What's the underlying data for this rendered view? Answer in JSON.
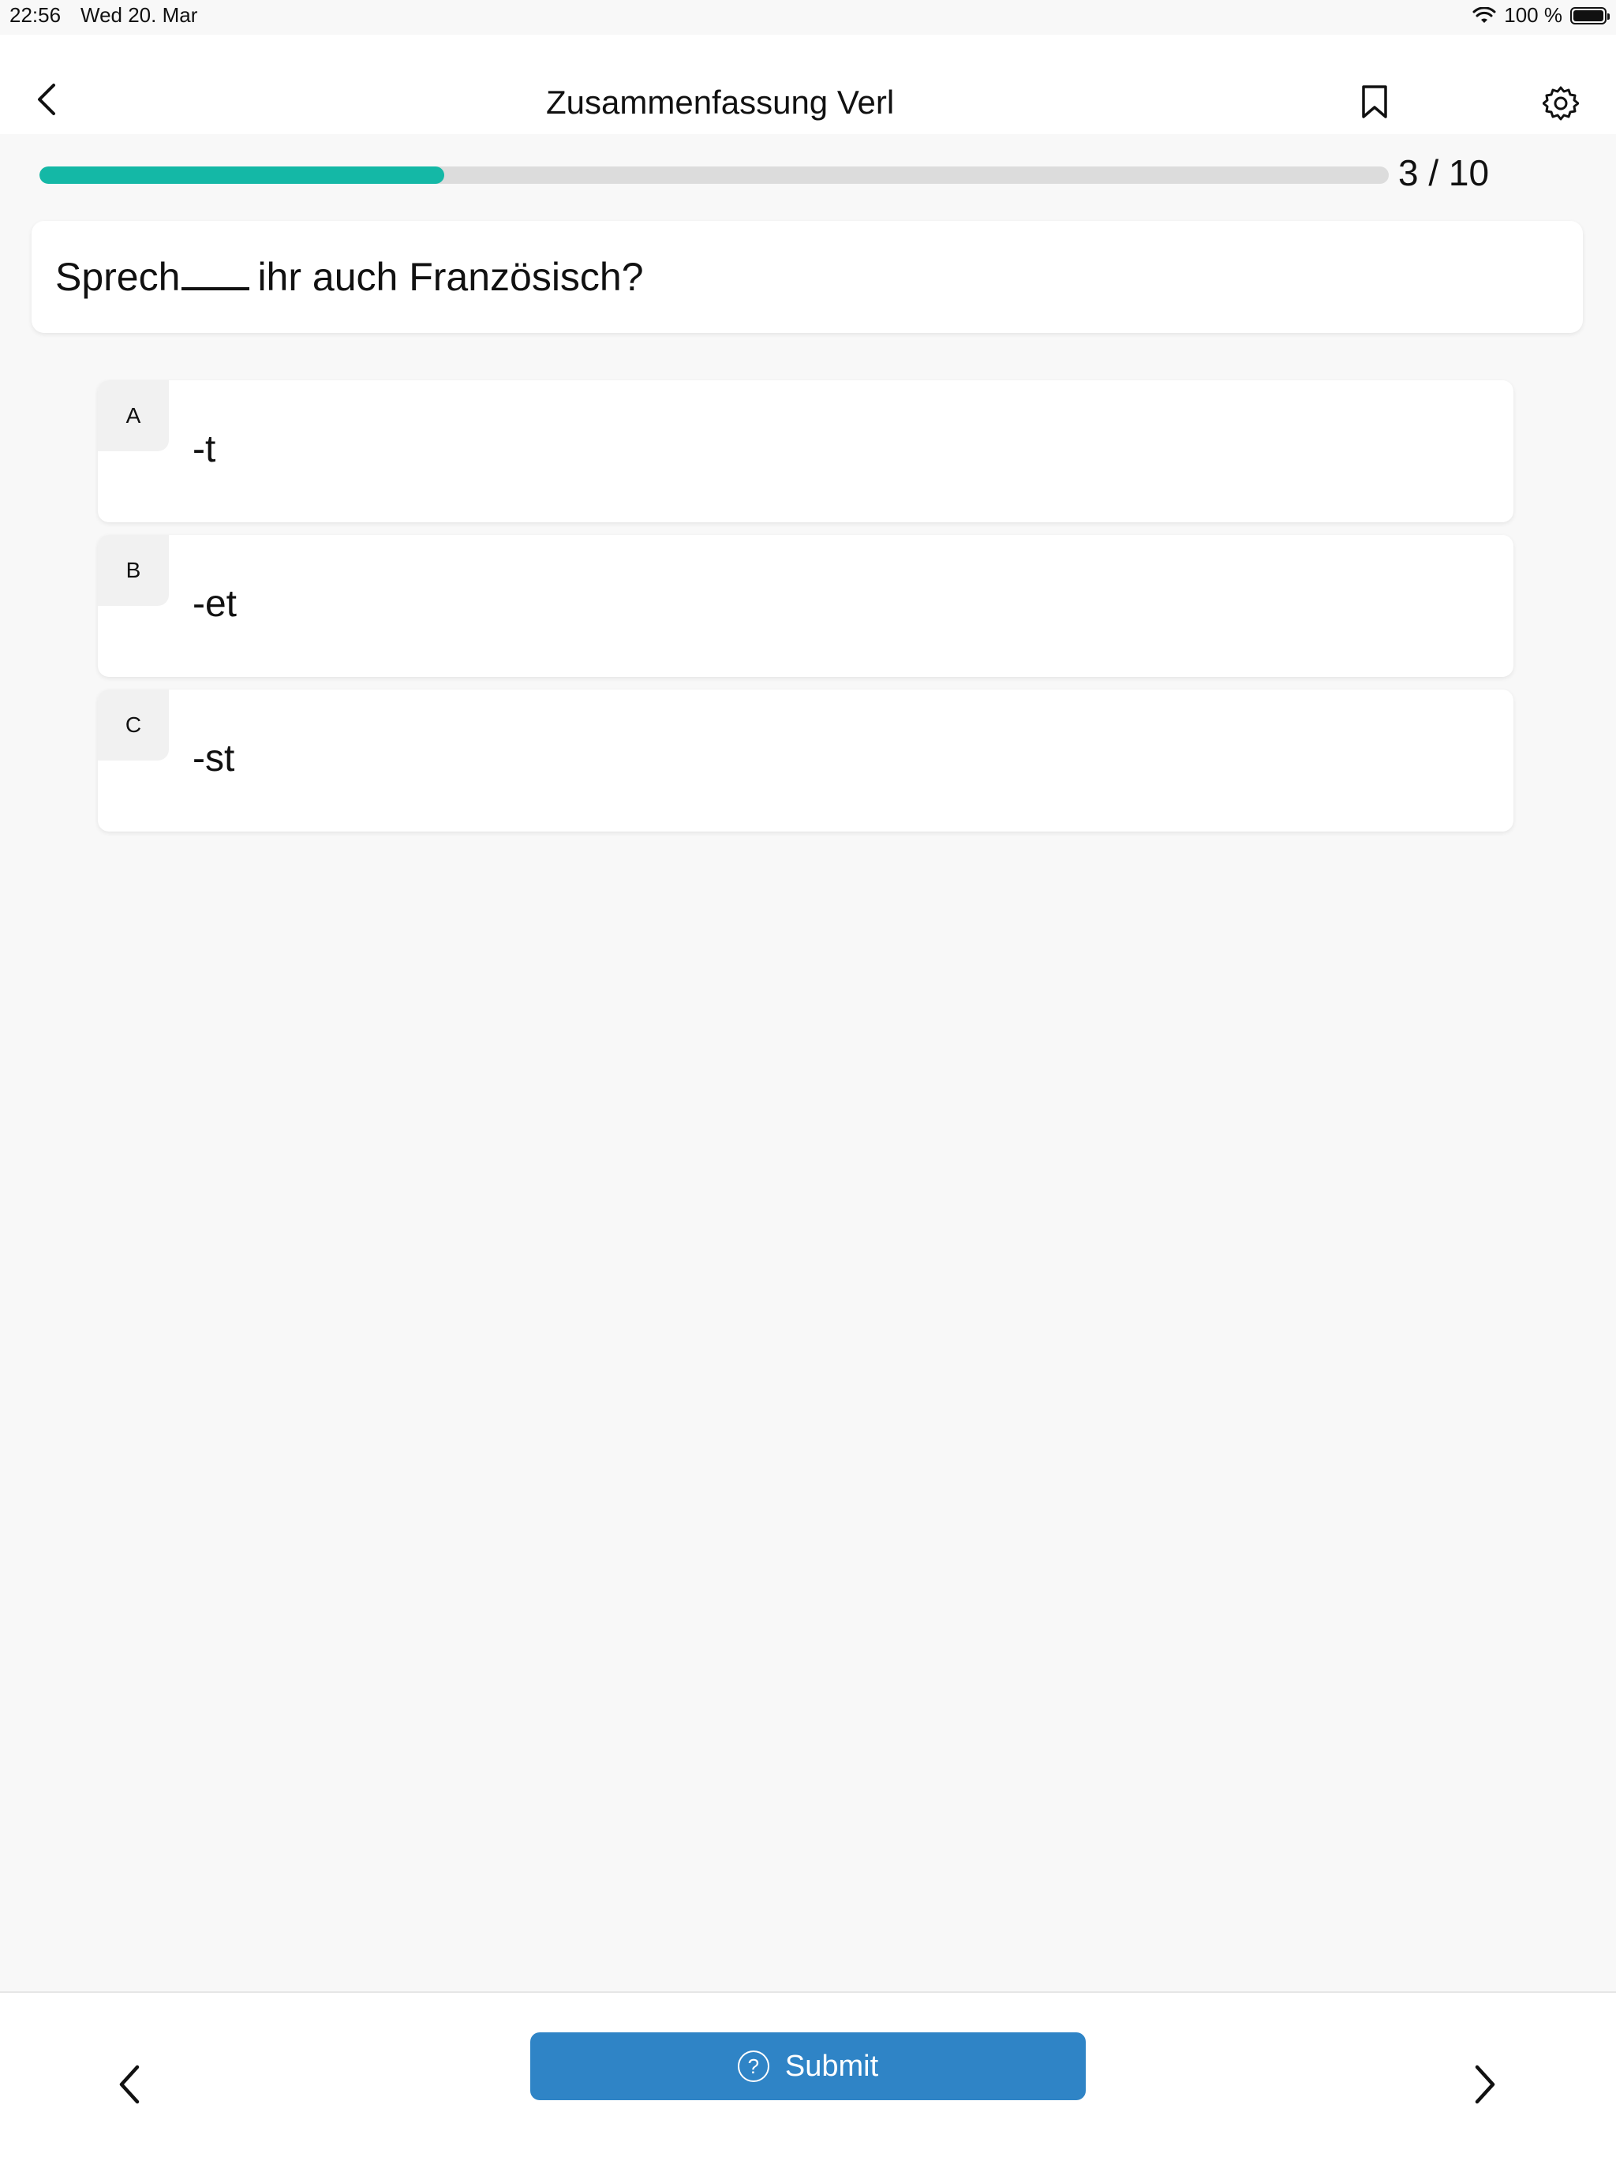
{
  "status_bar": {
    "time": "22:56",
    "date": "Wed 20. Mar",
    "battery_text": "100 %"
  },
  "header": {
    "title": "Zusammenfassung Verl",
    "back_icon": "chevron-left-icon",
    "bookmark_icon": "bookmark-icon",
    "settings_icon": "gear-icon"
  },
  "progress": {
    "current": 3,
    "total": 10,
    "fraction": 0.3,
    "label": "3 / 10",
    "color": "#14b8a6"
  },
  "question": {
    "before": "Sprech",
    "after": "ihr auch Französisch?"
  },
  "options": [
    {
      "letter": "A",
      "text": "-t"
    },
    {
      "letter": "B",
      "text": "-et"
    },
    {
      "letter": "C",
      "text": "-st"
    }
  ],
  "footer": {
    "submit_label": "Submit",
    "help_glyph": "?",
    "submit_color": "#2f84c6",
    "prev_icon": "chevron-left-icon",
    "next_icon": "chevron-right-icon"
  }
}
